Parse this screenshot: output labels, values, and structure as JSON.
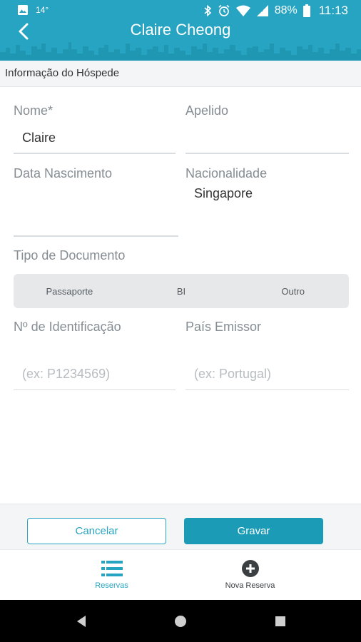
{
  "status_bar": {
    "temperature": "14°",
    "battery": "88%",
    "time": "11:13"
  },
  "header": {
    "title": "Claire Cheong",
    "color": "#27a4c1"
  },
  "section": {
    "title": "Informação do Hóspede"
  },
  "form": {
    "first_name": {
      "label": "Nome*",
      "value": "Claire"
    },
    "last_name": {
      "label": "Apelido",
      "value": ""
    },
    "birth_date": {
      "label": "Data Nascimento",
      "value": ""
    },
    "nationality": {
      "label": "Nacionalidade",
      "value": "Singapore"
    },
    "document_type": {
      "label": "Tipo de Documento",
      "options": [
        "Passaporte",
        "BI",
        "Outro"
      ]
    },
    "id_number": {
      "label": "Nº de Identificação",
      "placeholder": "(ex: P1234569)"
    },
    "issuing_country": {
      "label": "País Emissor",
      "placeholder": "(ex: Portugal)"
    }
  },
  "actions": {
    "cancel": "Cancelar",
    "save": "Gravar"
  },
  "bottom_nav": {
    "reservas": "Reservas",
    "nova_reserva": "Nova Reserva",
    "active_color": "#27a4c1"
  }
}
